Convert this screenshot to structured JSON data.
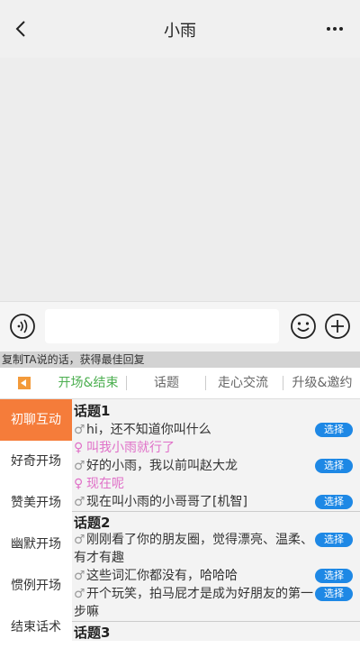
{
  "header": {
    "title": "小雨"
  },
  "hint_text": "复制TA说的话，获得最佳回复",
  "tabs": [
    "开场&结束",
    "话题",
    "走心交流",
    "升级&邀约"
  ],
  "sidebar": [
    "初聊互动",
    "好奇开场",
    "赞美开场",
    "幽默开场",
    "惯例开场",
    "结束话术"
  ],
  "topics": [
    {
      "title": "话题1",
      "lines": [
        {
          "sym": "♂",
          "text": "hi，还不知道你叫什么",
          "choose": "选择"
        },
        {
          "sym": "♀",
          "text": "叫我小雨就行了"
        },
        {
          "sym": "♂",
          "text": "好的小雨，我以前叫赵大龙",
          "choose": "选择"
        },
        {
          "sym": "♀",
          "text": "现在呢"
        },
        {
          "sym": "♂",
          "text": "现在叫小雨的小哥哥了[机智]",
          "choose": "选择"
        }
      ]
    },
    {
      "title": "话题2",
      "lines": [
        {
          "sym": "♂",
          "text": "刚刚看了你的朋友圈，觉得漂亮、温柔、有才有趣",
          "choose": "选择"
        },
        {
          "sym": "♂",
          "text": "这些词汇你都没有，哈哈哈",
          "choose": "选择"
        },
        {
          "sym": "♂",
          "text": "开个玩笑，拍马屁才是成为好朋友的第一步嘛",
          "choose": "选择"
        }
      ]
    },
    {
      "title": "话题3",
      "lines": []
    }
  ],
  "colors": {
    "accent_orange": "#f57c3a",
    "active_tab": "#4caf50",
    "choose_blue": "#1e88e5",
    "female": "#e070c8"
  }
}
